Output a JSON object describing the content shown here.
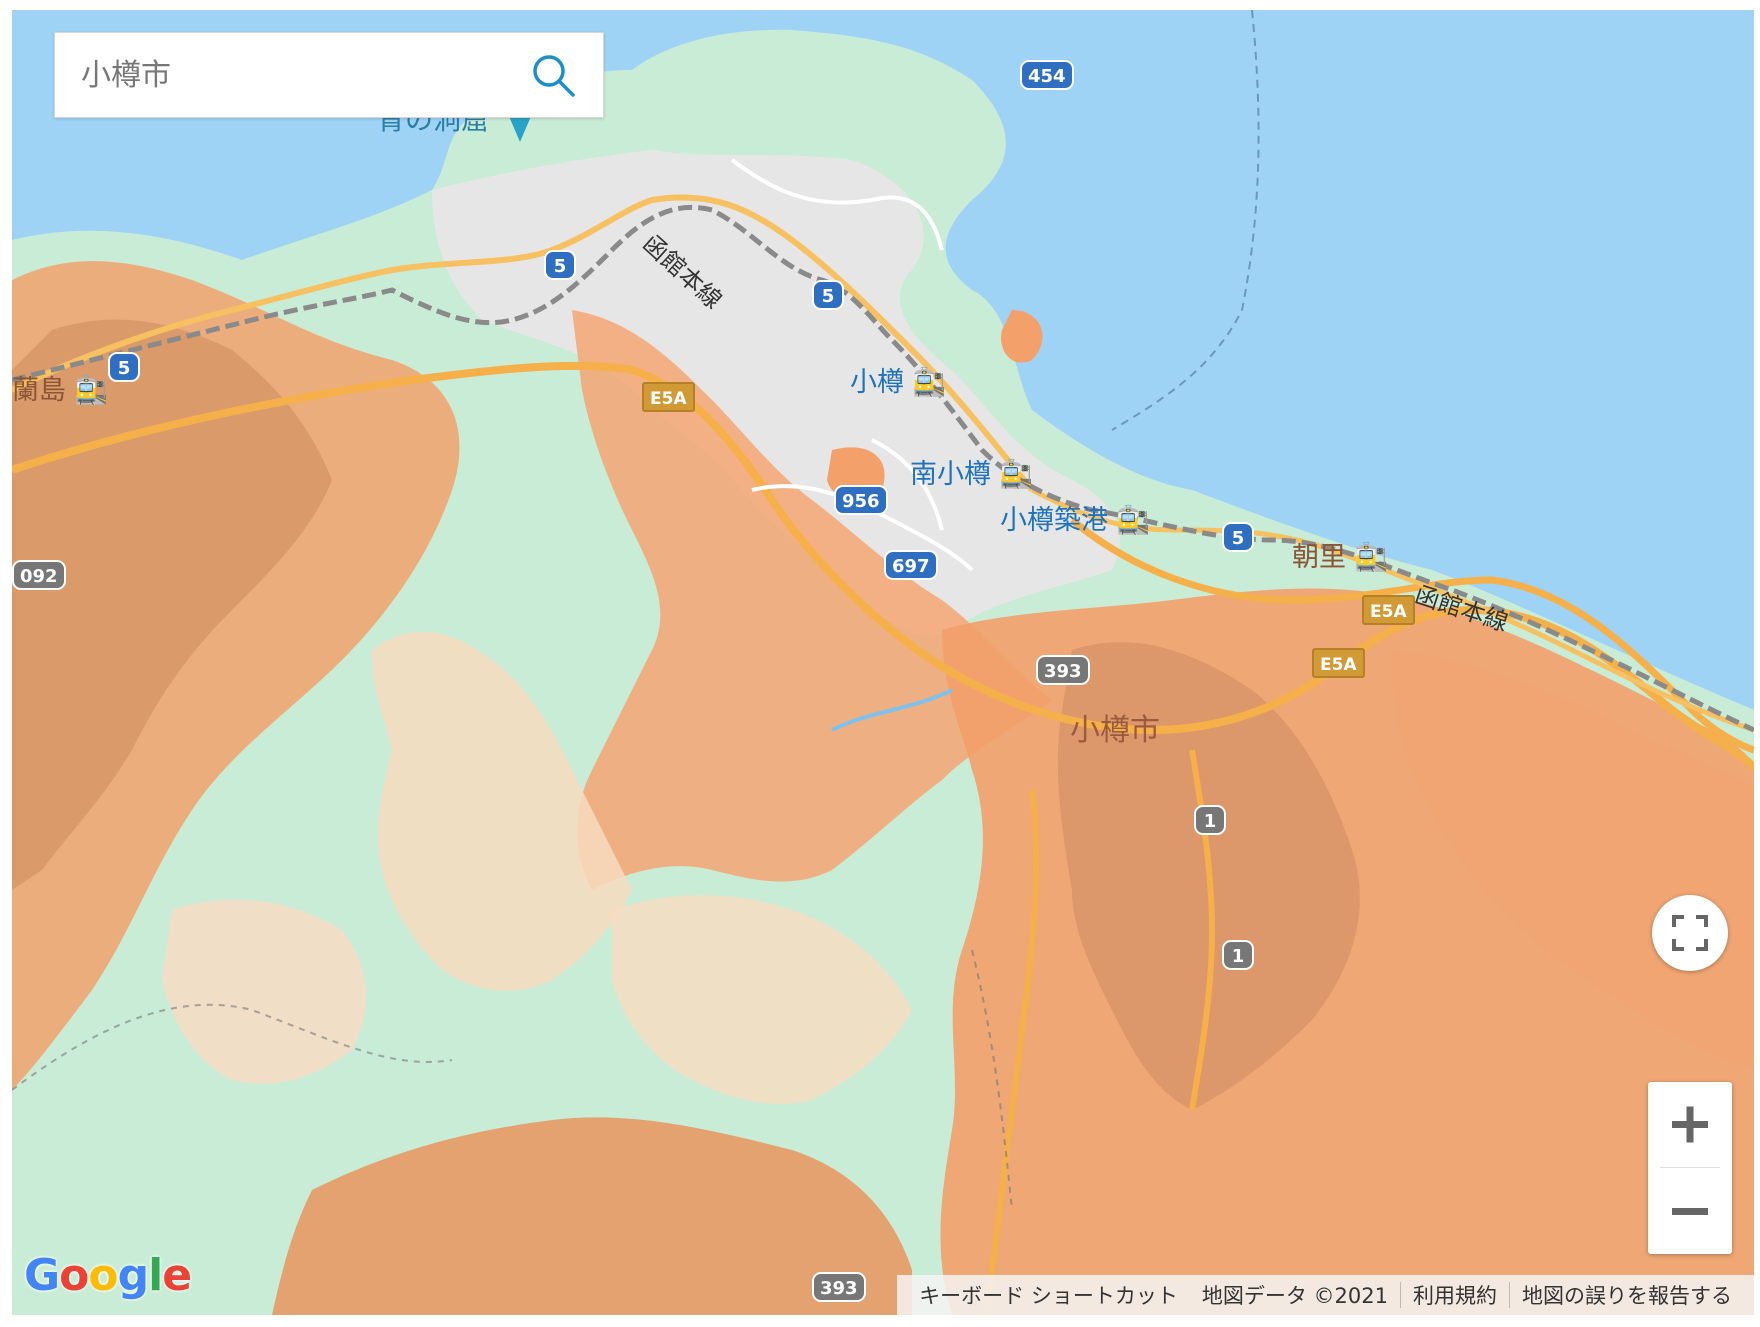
{
  "search": {
    "placeholder": "小樽市"
  },
  "icons": {
    "search": "search-icon",
    "fullscreen": "fullscreen-icon",
    "zoom_in": "plus-icon",
    "zoom_out": "minus-icon",
    "train": "train-icon"
  },
  "poi": {
    "label": "青の洞窟"
  },
  "places": {
    "city_main": "小樽市",
    "otaru": "小樽",
    "minami_otaru": "南小樽",
    "otaru_chikko": "小樽築港",
    "asari": "朝里",
    "ranshima": "蘭島"
  },
  "rail": {
    "line1": "函館本線",
    "line2": "函館本線"
  },
  "shields": {
    "r454": "454",
    "r5a": "5",
    "r5b": "5",
    "r5c": "5",
    "r5d": "5",
    "r956": "956",
    "r697": "697",
    "r393a": "393",
    "r393b": "393",
    "r1a": "1",
    "r1b": "1",
    "r092": "092",
    "e5a1": "E5A",
    "e5a2": "E5A",
    "e5a3": "E5A"
  },
  "controls": {
    "zoom_in": "+",
    "zoom_out": "−"
  },
  "logo": "Google",
  "attribution": {
    "shortcuts": "キーボード ショートカット",
    "data": "地図データ ©2021",
    "terms": "利用規約",
    "report": "地図の誤りを報告する"
  },
  "colors": {
    "water": "#9fd3f6",
    "forest": "#c9ecd6",
    "hazard_orange": "#f4a06b",
    "hazard_brown": "#d99a6a",
    "urban": "#e8e8e8",
    "highway": "#f7b24a"
  }
}
